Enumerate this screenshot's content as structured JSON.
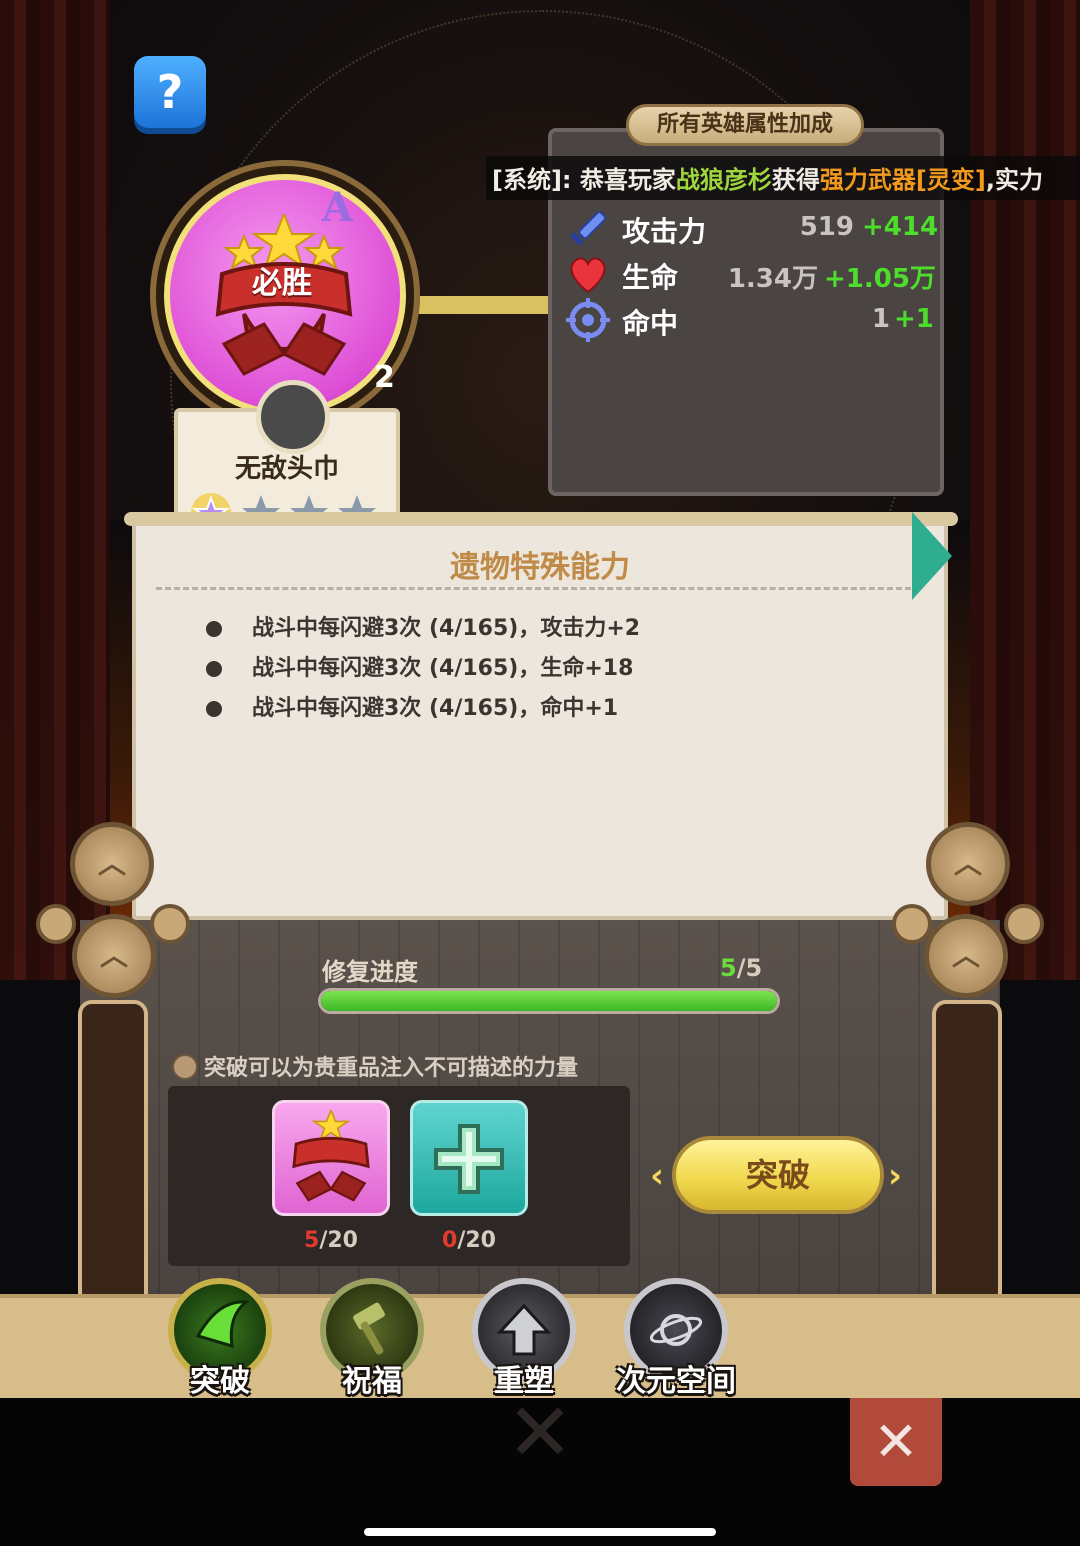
{
  "help_button": {
    "label": "?"
  },
  "relic": {
    "grade": "A",
    "level": "2",
    "emblem_text": "必胜",
    "name": "无敌头巾",
    "stars_total": 4,
    "stars_filled": 1
  },
  "stats_panel": {
    "title": "所有英雄属性加成",
    "rows": [
      {
        "icon": "sword-icon",
        "label": "攻击力",
        "base": "519",
        "bonus": "+414"
      },
      {
        "icon": "heart-icon",
        "label": "生命",
        "base": "1.34万",
        "bonus": "+1.05万"
      },
      {
        "icon": "crosshair-icon",
        "label": "命中",
        "base": "1",
        "bonus": "+1"
      }
    ]
  },
  "system_message": {
    "prefix": "[系统]: 恭喜玩家",
    "player": "战狼彦杉",
    "mid": "获得",
    "item": "强力武器[灵变]",
    "tail": ",实力"
  },
  "ability": {
    "title": "遗物特殊能力",
    "lines": [
      "战斗中每闪避3次 (4/165)，攻击力+2",
      "战斗中每闪避3次 (4/165)，生命+18",
      "战斗中每闪避3次 (4/165)，命中+1"
    ]
  },
  "repair": {
    "label": "修复进度",
    "current": "5",
    "separator": "/",
    "max": "5",
    "fraction": 1.0
  },
  "breakthrough": {
    "hint": "突破可以为贵重品注入不可描述的力量",
    "materials": [
      {
        "icon": "bisheng-headband-icon",
        "have": "5",
        "need": "/20"
      },
      {
        "icon": "cross-shard-icon",
        "have": "0",
        "need": "/20"
      }
    ],
    "button_label": "突破",
    "prev_arrow": "‹",
    "next_arrow": "›"
  },
  "tabs": [
    {
      "label": "突破",
      "icon": "claw-icon",
      "color": "#1f4a12"
    },
    {
      "label": "祝福",
      "icon": "hammer-icon",
      "color": "#3a4a18"
    },
    {
      "label": "重塑",
      "icon": "upgrade-arrow-icon",
      "color": "#2c2c30"
    },
    {
      "label": "次元空间",
      "icon": "planet-icon",
      "color": "#2a2a30"
    }
  ],
  "close_label": "✕"
}
